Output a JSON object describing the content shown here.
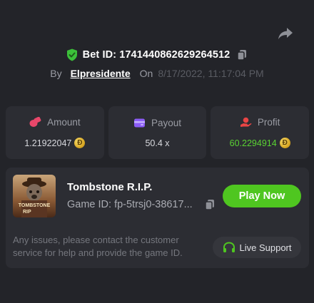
{
  "bet": {
    "label": "Bet ID:",
    "id": "1741440862629264512",
    "text": "Bet ID: 1741440862629264512"
  },
  "byline": {
    "by": "By",
    "user": "Elpresidente",
    "on": "On",
    "date": "8/17/2022, 11:17:04 PM"
  },
  "stats": {
    "amount": {
      "label": "Amount",
      "value": "1.21922047",
      "coin": "Ð"
    },
    "payout": {
      "label": "Payout",
      "value": "50.4 x"
    },
    "profit": {
      "label": "Profit",
      "value": "60.2294914",
      "coin": "Ð"
    }
  },
  "game": {
    "title": "Tombstone R.I.P.",
    "id_text": "Game ID: fp-5trsj0-38617...",
    "thumb_line1": "TOMBSTONE",
    "thumb_line2": "RIP",
    "play_label": "Play Now"
  },
  "support": {
    "help_text": "Any issues, please contact the customer service for help and provide the game ID.",
    "button_label": "Live Support"
  },
  "colors": {
    "background": "#232429",
    "card": "#2c2d33",
    "accent_green": "#4fc620",
    "profit_green": "#5ad233",
    "amount_icon": "#e8476a",
    "payout_icon": "#8b5cf6",
    "profit_icon": "#e84545"
  },
  "icons": {
    "share": "share-arrow-icon",
    "verified": "shield-check-icon",
    "copy": "copy-icon",
    "amount": "bet-chips-icon",
    "payout": "wallet-icon",
    "profit": "hand-coins-icon",
    "support": "headset-icon",
    "coin": "dogecoin-icon"
  }
}
